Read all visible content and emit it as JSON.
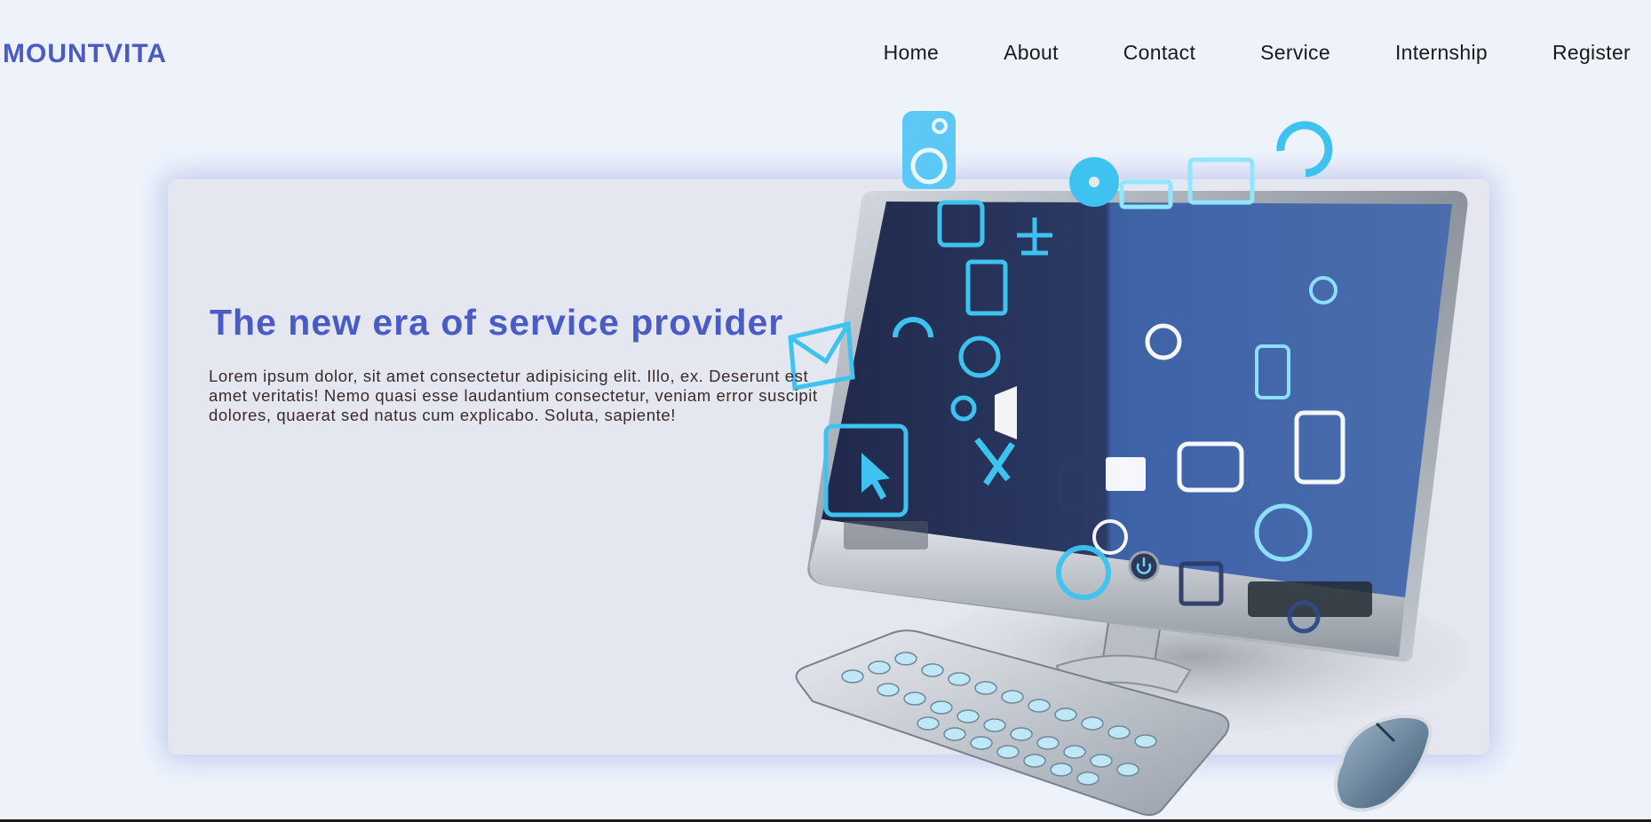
{
  "brand": {
    "name": "MOUNTVITA"
  },
  "nav": {
    "items": [
      {
        "label": "Home"
      },
      {
        "label": "About"
      },
      {
        "label": "Contact"
      },
      {
        "label": "Service"
      },
      {
        "label": "Internship"
      },
      {
        "label": "Register"
      }
    ]
  },
  "hero": {
    "title": "The new era of service provider",
    "text": "Lorem ipsum dolor, sit amet consectetur adipisicing elit. Illo, ex. Deserunt est amet veritatis! Nemo quasi esse laudantium consectetur, veniam error suscipit dolores, quaerat sed natus cum explicabo. Soluta, sapiente!"
  },
  "colors": {
    "accent": "#4a5bc4",
    "background": "#eef3fb",
    "card": "#e4e7f0",
    "icon_blue": "#3ec3f0"
  }
}
